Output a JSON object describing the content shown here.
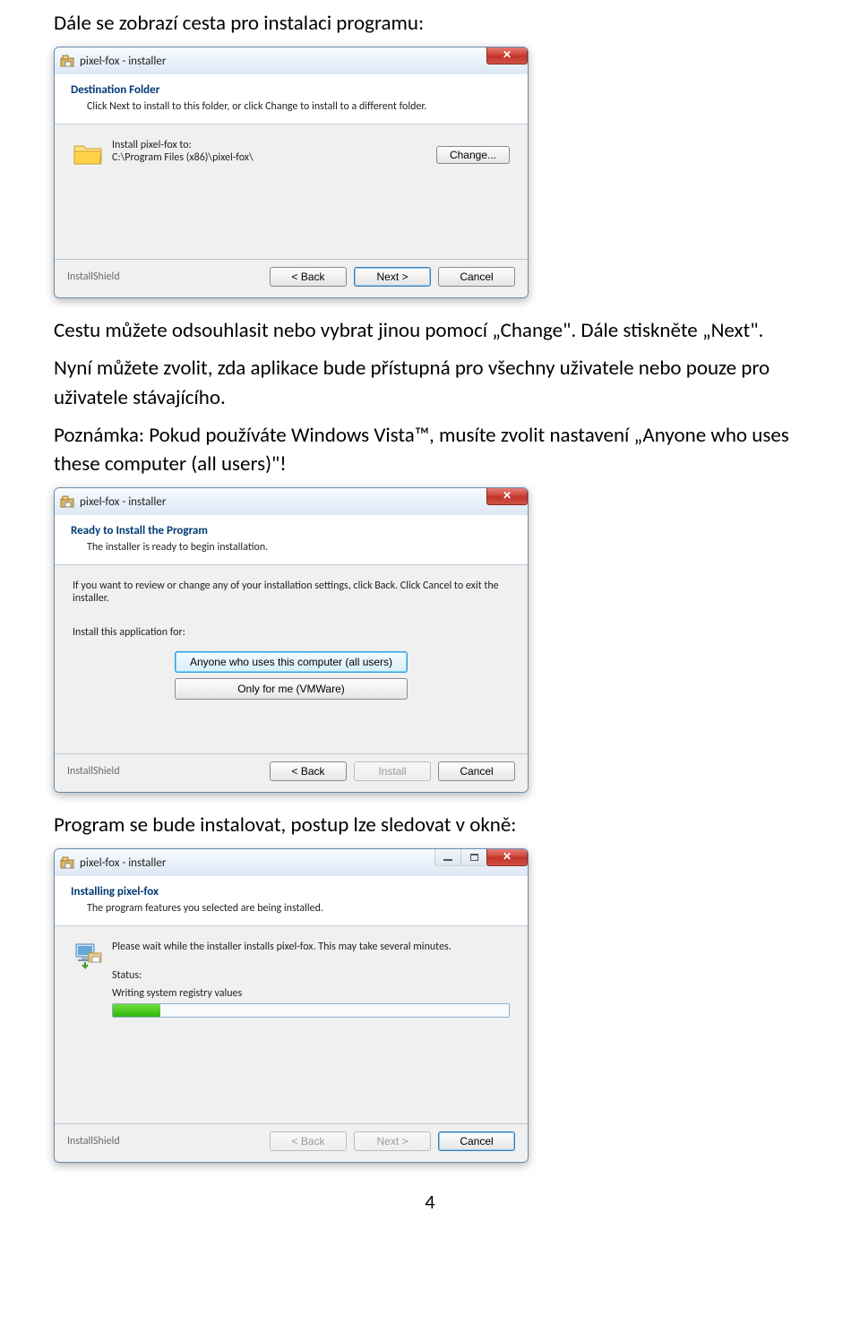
{
  "doc": {
    "intro": "Dále se zobrazí cesta pro instalaci programu:",
    "para1": "Cestu můžete odsouhlasit nebo vybrat jinou pomocí „Change\". Dále stiskněte „Next\".",
    "para2": "Nyní můžete zvolit, zda aplikace bude přístupná pro všechny uživatele nebo pouze pro uživatele stávajícího.",
    "para3": "Poznámka: Pokud používáte Windows Vista™, musíte zvolit nastavení „Anyone who uses these computer (all users)\"!",
    "para4": "Program se bude instalovat, postup lze sledovat v okně:",
    "page_number": "4"
  },
  "common": {
    "window_title": "pixel-fox - installer",
    "brand": "InstallShield",
    "back": "< Back",
    "next": "Next >",
    "install": "Install",
    "cancel": "Cancel"
  },
  "dlg1": {
    "heading": "Destination Folder",
    "sub": "Click Next to install to this folder, or click Change to install to a different folder.",
    "install_to": "Install pixel-fox to:",
    "path": "C:\\Program Files (x86)\\pixel-fox\\",
    "change": "Change..."
  },
  "dlg2": {
    "heading": "Ready to Install the Program",
    "sub": "The installer is ready to begin installation.",
    "body1": "If you want to review or change any of your installation settings, click Back. Click Cancel to exit the installer.",
    "body2": "Install this application for:",
    "opt_all": "Anyone who uses this computer (all users)",
    "opt_me": "Only for me (VMWare)"
  },
  "dlg3": {
    "heading": "Installing pixel-fox",
    "sub": "The program features you selected are being installed.",
    "wait": "Please wait while the installer installs pixel-fox. This may take several minutes.",
    "status_label": "Status:",
    "status_text": "Writing system registry values"
  }
}
